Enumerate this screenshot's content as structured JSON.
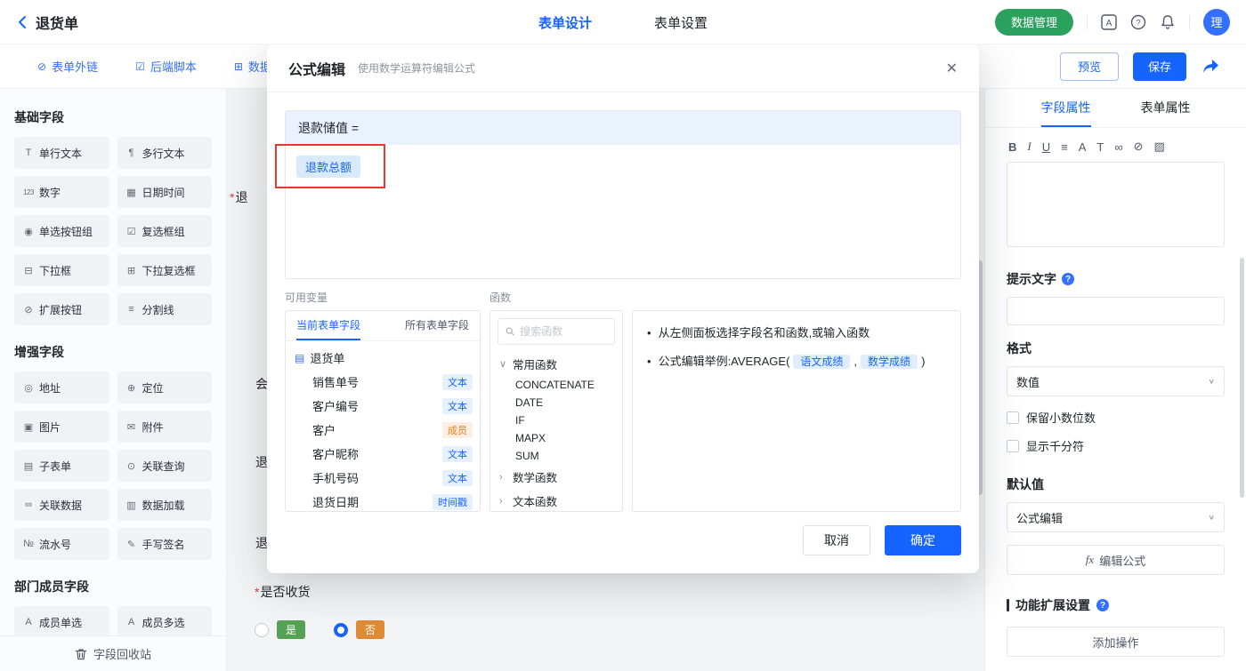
{
  "icons": {
    "chevron_down": "∨",
    "chevron_right": "›",
    "help": "?",
    "close": "✕",
    "bullet": "•",
    "doc": "▤"
  },
  "header": {
    "title": "退货单",
    "tabs": [
      {
        "label": "表单设计"
      },
      {
        "label": "表单设置"
      }
    ],
    "data_manage": "数据管理",
    "avatar": "理"
  },
  "toolbar": {
    "items": [
      {
        "icon": "⊘",
        "label": "表单外链"
      },
      {
        "icon": "☑",
        "label": "后端脚本"
      },
      {
        "icon": "⊞",
        "label": "数据权"
      }
    ],
    "preview": "预览",
    "save": "保存"
  },
  "sidebar": {
    "sections": [
      {
        "title": "基础字段",
        "items": [
          {
            "icon": "T",
            "label": "单行文本"
          },
          {
            "icon": "¶",
            "label": "多行文本"
          },
          {
            "icon": "123",
            "label": "数字"
          },
          {
            "icon": "▦",
            "label": "日期时间"
          },
          {
            "icon": "◉",
            "label": "单选按钮组"
          },
          {
            "icon": "☑",
            "label": "复选框组"
          },
          {
            "icon": "⊟",
            "label": "下拉框"
          },
          {
            "icon": "⊞",
            "label": "下拉复选框"
          },
          {
            "icon": "⊘",
            "label": "扩展按钮"
          },
          {
            "icon": "≡",
            "label": "分割线"
          }
        ]
      },
      {
        "title": "增强字段",
        "items": [
          {
            "icon": "◎",
            "label": "地址"
          },
          {
            "icon": "⊕",
            "label": "定位"
          },
          {
            "icon": "▣",
            "label": "图片"
          },
          {
            "icon": "✉",
            "label": "附件"
          },
          {
            "icon": "▤",
            "label": "子表单"
          },
          {
            "icon": "⊙",
            "label": "关联查询"
          },
          {
            "icon": "∞",
            "label": "关联数据"
          },
          {
            "icon": "▥",
            "label": "数据加载"
          },
          {
            "icon": "№",
            "label": "流水号"
          },
          {
            "icon": "✎",
            "label": "手写签名"
          }
        ]
      },
      {
        "title": "部门成员字段",
        "items": [
          {
            "icon": "A",
            "label": "成员单选"
          },
          {
            "icon": "A",
            "label": "成员多选"
          }
        ]
      }
    ],
    "recycle_bin": "字段回收站"
  },
  "canvas": {
    "peeks": [
      {
        "required": "*",
        "text": "退"
      },
      {
        "required": "",
        "text": "会"
      },
      {
        "required": "",
        "text": "退"
      },
      {
        "required": "",
        "text": "退"
      }
    ],
    "receive_field": {
      "required": "*",
      "label": "是否收货",
      "options": [
        {
          "label": "是"
        },
        {
          "label": "否"
        }
      ]
    }
  },
  "modal": {
    "title": "公式编辑",
    "subtitle": "使用数学运算符编辑公式",
    "formula_lhs": "退款储值 =",
    "formula_chip": "退款总额",
    "variables": {
      "label": "可用变量",
      "tabs": [
        {
          "label": "当前表单字段"
        },
        {
          "label": "所有表单字段"
        }
      ],
      "form_name": "退货单",
      "fields": [
        {
          "name": "销售单号",
          "type": "文本"
        },
        {
          "name": "客户编号",
          "type": "文本"
        },
        {
          "name": "客户",
          "type": "成员"
        },
        {
          "name": "客户昵称",
          "type": "文本"
        },
        {
          "name": "手机号码",
          "type": "文本"
        },
        {
          "name": "退货日期",
          "type": "时间戳"
        }
      ]
    },
    "functions": {
      "label": "函数",
      "search_placeholder": "搜索函数",
      "group_common": "常用函数",
      "common_items": [
        "CONCATENATE",
        "DATE",
        "IF",
        "MAPX",
        "SUM"
      ],
      "group_math": "数学函数",
      "group_text": "文本函数"
    },
    "help": {
      "line1": "从左侧面板选择字段名和函数,或输入函数",
      "line2_prefix": "公式编辑举例:AVERAGE(",
      "chip1": "语文成绩",
      "comma": ",",
      "chip2": "数学成绩",
      "line2_suffix": ")"
    },
    "cancel": "取消",
    "confirm": "确定"
  },
  "props": {
    "tabs": [
      {
        "label": "字段属性"
      },
      {
        "label": "表单属性"
      }
    ],
    "rt_icons": [
      "B",
      "I",
      "U",
      "≡",
      "A",
      "T",
      "∞",
      "⊘",
      "▨"
    ],
    "hint_label": "提示文字",
    "format_label": "格式",
    "format_value": "数值",
    "opt_decimal": "保留小数位数",
    "opt_thousand": "显示千分符",
    "default_label": "默认值",
    "default_value": "公式编辑",
    "fx_icon": "fx",
    "fx_button": "编辑公式",
    "ext_title": "功能扩展设置",
    "add_action": "添加操作"
  },
  "colors": {
    "primary": "#1664ff",
    "green": "#2ba15e",
    "orange": "#f77c1a",
    "annotation_red": "#e6392e"
  }
}
